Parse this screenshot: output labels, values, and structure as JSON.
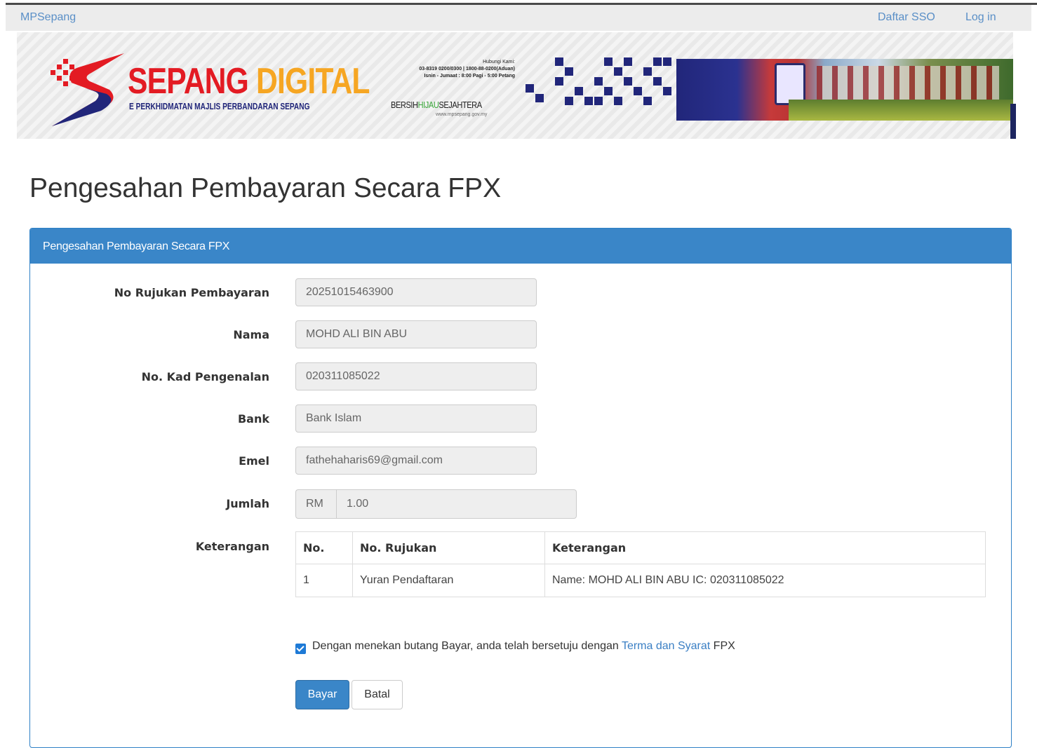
{
  "navbar": {
    "brand": "MPSepang",
    "daftar_sso": "Daftar SSO",
    "log_in": "Log in"
  },
  "banner": {
    "title_part1": "SEPANG",
    "title_part2": "DIGITAL",
    "subtitle": "E PERKHIDMATAN MAJLIS PERBANDARAN SEPANG",
    "hotline": "Hubungi Kami:",
    "hotline_numbers": "03-8319 0200/0300 | 1800-88-0200(Aduan)",
    "hotline_hours": "Isnin - Jumaat : 8:00 Pagi - 5:00 Petang",
    "slogan_part1": "BERSIH",
    "slogan_part2": "HIJAU",
    "slogan_part3": "SEJAHTERA",
    "url": "www.mpsepang.gov.my",
    "colors": {
      "red": "#e31b23",
      "orange": "#f6a623",
      "navy": "#21267a"
    }
  },
  "page_title": "Pengesahan Pembayaran Secara FPX",
  "panel": {
    "heading": "Pengesahan Pembayaran Secara FPX",
    "fields": {
      "no_rujukan_label": "No Rujukan Pembayaran",
      "no_rujukan_value": "20251015463900",
      "nama_label": "Nama",
      "nama_value": "MOHD ALI BIN ABU",
      "ic_label": "No. Kad Pengenalan",
      "ic_value": "020311085022",
      "bank_label": "Bank",
      "bank_value": "Bank Islam",
      "emel_label": "Emel",
      "emel_value": "fathehaharis69@gmail.com",
      "jumlah_label": "Jumlah",
      "currency": "RM",
      "jumlah_value": "1.00",
      "keterangan_label": "Keterangan"
    },
    "table": {
      "headers": [
        "No.",
        "No. Rujukan",
        "Keterangan"
      ],
      "rows": [
        [
          "1",
          "Yuran Pendaftaran",
          "Name: MOHD ALI BIN ABU IC: 020311085022"
        ]
      ]
    },
    "agreement": {
      "checked": true,
      "text_before": "Dengan menekan butang Bayar, anda telah bersetuju dengan ",
      "link": "Terma dan Syarat",
      "text_after": " FPX"
    },
    "buttons": {
      "pay": "Bayar",
      "cancel": "Batal"
    },
    "accent_color": "#3a86c8"
  }
}
